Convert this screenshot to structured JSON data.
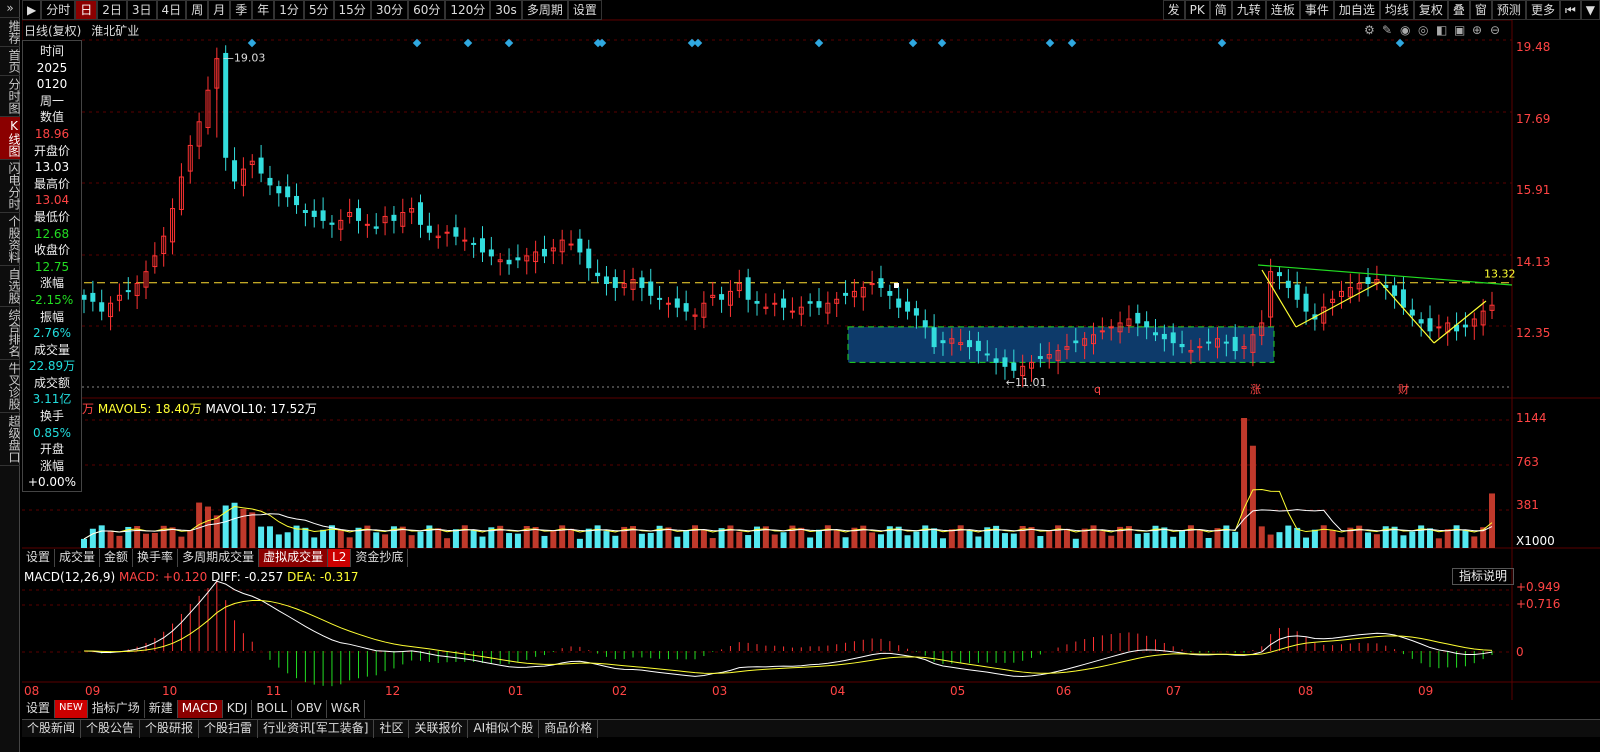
{
  "topbar": {
    "timeframes": [
      "分时",
      "日",
      "2日",
      "3日",
      "4日",
      "周",
      "月",
      "季",
      "年",
      "1分",
      "5分",
      "15分",
      "30分",
      "60分",
      "120分",
      "30s",
      "多周期",
      "设置"
    ],
    "active_timeframe": "日",
    "tools": [
      "发",
      "PK",
      "简",
      "九转",
      "连板",
      "事件",
      "加自选",
      "均线",
      "复权",
      "叠",
      "窗",
      "预测",
      "更多"
    ]
  },
  "leftnav": {
    "expand": "»",
    "items": [
      "推荐",
      "首页",
      "分时图",
      "K线图",
      "闪电分时",
      "个股资料",
      "自选股",
      "综合排名",
      "牛叉诊股",
      "超级盘口"
    ],
    "active": "K线图"
  },
  "chart": {
    "mode": "日线(复权)",
    "stock": "淮北矿业",
    "hline": "13.32",
    "high_annot": "19.03",
    "low_annot": "11.01",
    "event_marks": [
      "q",
      "涨",
      "财"
    ]
  },
  "info": {
    "time_label": "时间",
    "year": "2025",
    "date": "0120",
    "weekday": "周一",
    "value_label": "数值",
    "value": "18.96",
    "open_label": "开盘价",
    "open": "13.03",
    "high_label": "最高价",
    "high": "13.04",
    "low_label": "最低价",
    "low": "12.68",
    "close_label": "收盘价",
    "close": "12.75",
    "chg_label": "涨幅",
    "chg": "-2.15%",
    "amp_label": "振幅",
    "amp": "2.76%",
    "vol_label": "成交量",
    "vol": "22.89万",
    "amt_label": "成交额",
    "amt": "3.11亿",
    "turn_label": "换手",
    "turn": "0.85%",
    "open_chg_label1": "开盘",
    "open_chg_label2": "涨幅",
    "open_chg": "+0.00%"
  },
  "price_axis": [
    "19.48",
    "17.69",
    "15.91",
    "14.13",
    "12.35"
  ],
  "vol_axis": [
    "1144",
    "763",
    "381",
    "X1000"
  ],
  "macd_axis": [
    "+0.949",
    "+0.716",
    "0"
  ],
  "x_axis": [
    "08",
    "09",
    "10",
    "11",
    "12",
    "01",
    "02",
    "03",
    "04",
    "05",
    "06",
    "07",
    "08",
    "09"
  ],
  "vol_legend": {
    "unit": "万",
    "ma5_label": "MAVOL5:",
    "ma5": "18.40万",
    "ma10_label": "MAVOL10:",
    "ma10": "17.52万"
  },
  "macd_legend": {
    "name": "MACD(12,26,9)",
    "macd_label": "MACD:",
    "macd": "+0.120",
    "diff_label": "DIFF:",
    "diff": "-0.257",
    "dea_label": "DEA:",
    "dea": "-0.317"
  },
  "vol_tabs": [
    "设置",
    "成交量",
    "金额",
    "换手率",
    "多周期成交量",
    "虚拟成交量",
    "L2",
    "资金抄底"
  ],
  "ind_tabs": [
    "设置",
    "NEW",
    "指标广场",
    "新建",
    "MACD",
    "KDJ",
    "BOLL",
    "OBV",
    "W&R"
  ],
  "explain_btn": "指标说明",
  "bottom": [
    "个股新闻",
    "个股公告",
    "个股研报",
    "个股扫雷",
    "行业资讯[军工装备]",
    "社区",
    "关联报价",
    "AI相似个股",
    "商品价格"
  ],
  "colors": {
    "up": "#ff3333",
    "down": "#33dddd",
    "bg": "#000000",
    "ma5": "#ffff33",
    "ma10": "#ffffff",
    "active": "#8b0000"
  },
  "chart_data": {
    "type": "candlestick",
    "title": "淮北矿业 日线(复权)",
    "ylim": [
      10.6,
      19.6
    ],
    "x_months": [
      "08",
      "09",
      "10",
      "11",
      "12",
      "01",
      "02",
      "03",
      "04",
      "05",
      "06",
      "07",
      "08",
      "09"
    ],
    "key_points": {
      "high": 19.03,
      "low": 11.01,
      "reference_line": 13.32
    },
    "close_series": [
      12.9,
      12.85,
      12.6,
      12.8,
      13.0,
      13.1,
      13.3,
      13.6,
      14.0,
      14.5,
      15.2,
      16.0,
      16.8,
      17.4,
      18.2,
      19.0,
      16.5,
      15.9,
      16.2,
      16.4,
      16.1,
      15.8,
      15.6,
      15.5,
      15.3,
      15.1,
      15.0,
      14.9,
      14.8,
      14.9,
      15.1,
      14.9,
      14.8,
      14.7,
      15.0,
      14.9,
      15.1,
      15.2,
      14.8,
      14.6,
      14.5,
      14.6,
      14.5,
      14.4,
      14.3,
      14.1,
      14.0,
      13.9,
      13.8,
      13.9,
      14.0,
      14.1,
      14.0,
      14.2,
      14.4,
      14.3,
      14.1,
      13.7,
      13.5,
      13.3,
      13.2,
      13.3,
      13.4,
      13.2,
      13.0,
      12.9,
      12.8,
      12.7,
      12.6,
      12.5,
      12.8,
      13.0,
      12.9,
      13.1,
      13.3,
      12.9,
      12.8,
      12.7,
      12.8,
      12.7,
      12.6,
      12.7,
      12.8,
      12.7,
      12.8,
      12.9,
      13.0,
      13.1,
      13.2,
      13.3,
      13.2,
      13.0,
      12.7,
      12.6,
      12.5,
      12.2,
      11.7,
      11.8,
      11.9,
      11.8,
      11.7,
      11.6,
      11.5,
      11.3,
      11.2,
      11.1,
      11.2,
      11.3,
      11.4,
      11.5,
      11.6,
      11.7,
      11.8,
      11.9,
      12.0,
      12.1,
      12.2,
      12.3,
      12.4,
      12.3,
      12.2,
      12.0,
      11.9,
      11.8,
      11.7,
      11.6,
      11.7,
      11.8,
      11.9,
      11.8,
      11.6,
      11.7,
      12.0,
      12.3,
      13.6,
      13.5,
      13.2,
      12.9,
      12.6,
      12.4,
      12.7,
      12.9,
      13.1,
      13.2,
      13.3,
      13.3,
      13.4,
      13.2,
      13.0,
      12.7,
      12.5,
      12.3,
      12.1,
      12.2,
      12.3,
      12.1,
      12.2,
      12.4,
      12.6,
      12.75
    ]
  }
}
